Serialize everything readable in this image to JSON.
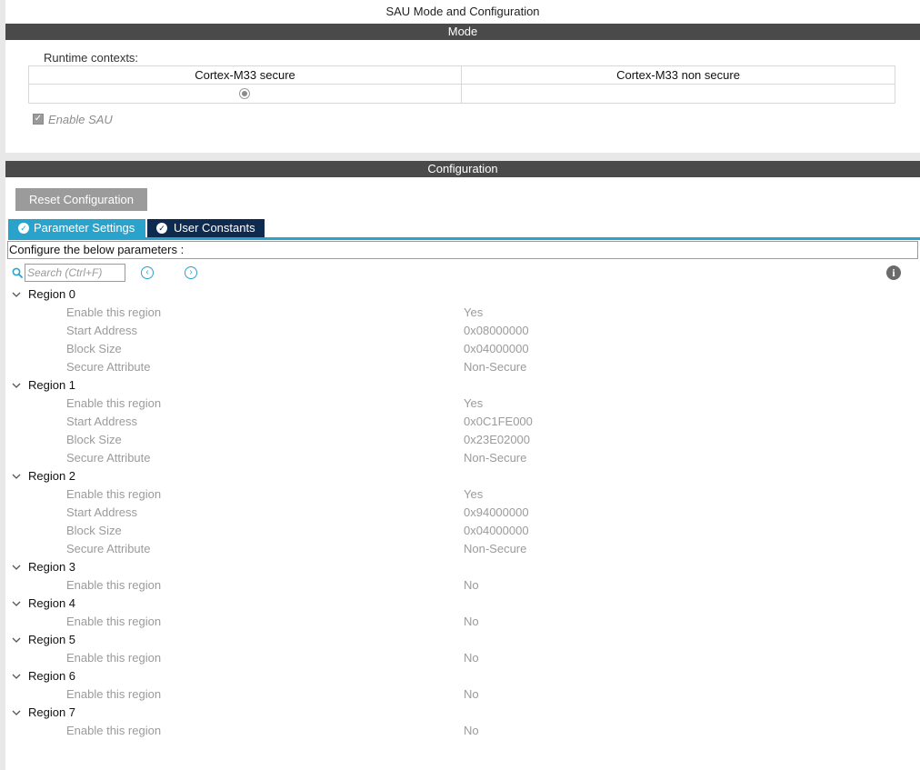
{
  "window": {
    "title": "SAU Mode and Configuration"
  },
  "mode": {
    "header": "Mode",
    "runtime_label": "Runtime contexts:",
    "contexts": [
      {
        "label": "Cortex-M33 secure",
        "selected": true
      },
      {
        "label": "Cortex-M33 non secure",
        "selected": false
      }
    ],
    "enable_sau": {
      "label": "Enable SAU",
      "checked": true,
      "disabled": true
    }
  },
  "configuration": {
    "header": "Configuration",
    "reset_label": "Reset Configuration",
    "tabs": [
      {
        "label": "Parameter Settings",
        "active": true
      },
      {
        "label": "User Constants",
        "active": false
      }
    ],
    "configure_label": "Configure the below parameters :",
    "search": {
      "placeholder": "Search (Ctrl+F)"
    },
    "regions": [
      {
        "label": "Region 0",
        "params": [
          {
            "name": "Enable this region",
            "value": "Yes"
          },
          {
            "name": "Start Address",
            "value": "0x08000000"
          },
          {
            "name": "Block Size",
            "value": "0x04000000"
          },
          {
            "name": "Secure Attribute",
            "value": "Non-Secure"
          }
        ]
      },
      {
        "label": "Region 1",
        "params": [
          {
            "name": "Enable this region",
            "value": "Yes"
          },
          {
            "name": "Start Address",
            "value": "0x0C1FE000"
          },
          {
            "name": "Block Size",
            "value": "0x23E02000"
          },
          {
            "name": "Secure Attribute",
            "value": "Non-Secure"
          }
        ]
      },
      {
        "label": "Region 2",
        "params": [
          {
            "name": "Enable this region",
            "value": "Yes"
          },
          {
            "name": "Start Address",
            "value": "0x94000000"
          },
          {
            "name": "Block Size",
            "value": "0x04000000"
          },
          {
            "name": "Secure Attribute",
            "value": "Non-Secure"
          }
        ]
      },
      {
        "label": "Region 3",
        "params": [
          {
            "name": "Enable this region",
            "value": "No"
          }
        ]
      },
      {
        "label": "Region 4",
        "params": [
          {
            "name": "Enable this region",
            "value": "No"
          }
        ]
      },
      {
        "label": "Region 5",
        "params": [
          {
            "name": "Enable this region",
            "value": "No"
          }
        ]
      },
      {
        "label": "Region 6",
        "params": [
          {
            "name": "Enable this region",
            "value": "No"
          }
        ]
      },
      {
        "label": "Region 7",
        "params": [
          {
            "name": "Enable this region",
            "value": "No"
          }
        ]
      }
    ]
  },
  "icons": {
    "search": "search-icon",
    "prev": "chevron-left-circle-icon",
    "next": "chevron-right-circle-icon",
    "info": "info-icon",
    "expand": "chevron-down-icon",
    "tab_tick": "check-circle-icon"
  },
  "colors": {
    "section_header": "#4a4a4a",
    "tab_active": "#2aa3cc",
    "tab_inactive": "#0e2a4e",
    "reset_button": "#9b9b9b",
    "disabled_text": "#9b9b9b"
  }
}
